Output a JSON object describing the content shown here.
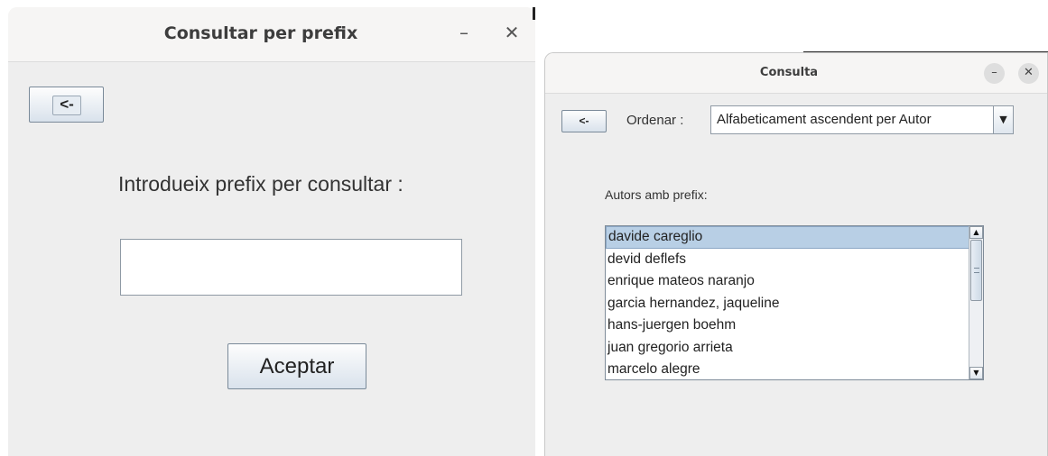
{
  "left_window": {
    "title": "Consultar per prefix",
    "minimize_glyph": "–",
    "close_glyph": "✕",
    "back_label": "<-",
    "prompt": "Introdueix prefix per consultar :",
    "prefix_value": "",
    "accept_label": "Aceptar"
  },
  "right_window": {
    "title": "Consulta",
    "minimize_glyph": "–",
    "close_glyph": "✕",
    "back_label": "<-",
    "order_label": "Ordenar :",
    "order_selected": "Alfabeticament ascendent per Autor",
    "list_label": "Autors amb prefix:",
    "authors": [
      "davide careglio",
      "devid deflefs",
      "enrique mateos naranjo",
      "garcia hernandez, jaqueline",
      "hans-juergen boehm",
      "juan gregorio arrieta",
      "marcelo alegre"
    ],
    "selected_index": 0
  }
}
